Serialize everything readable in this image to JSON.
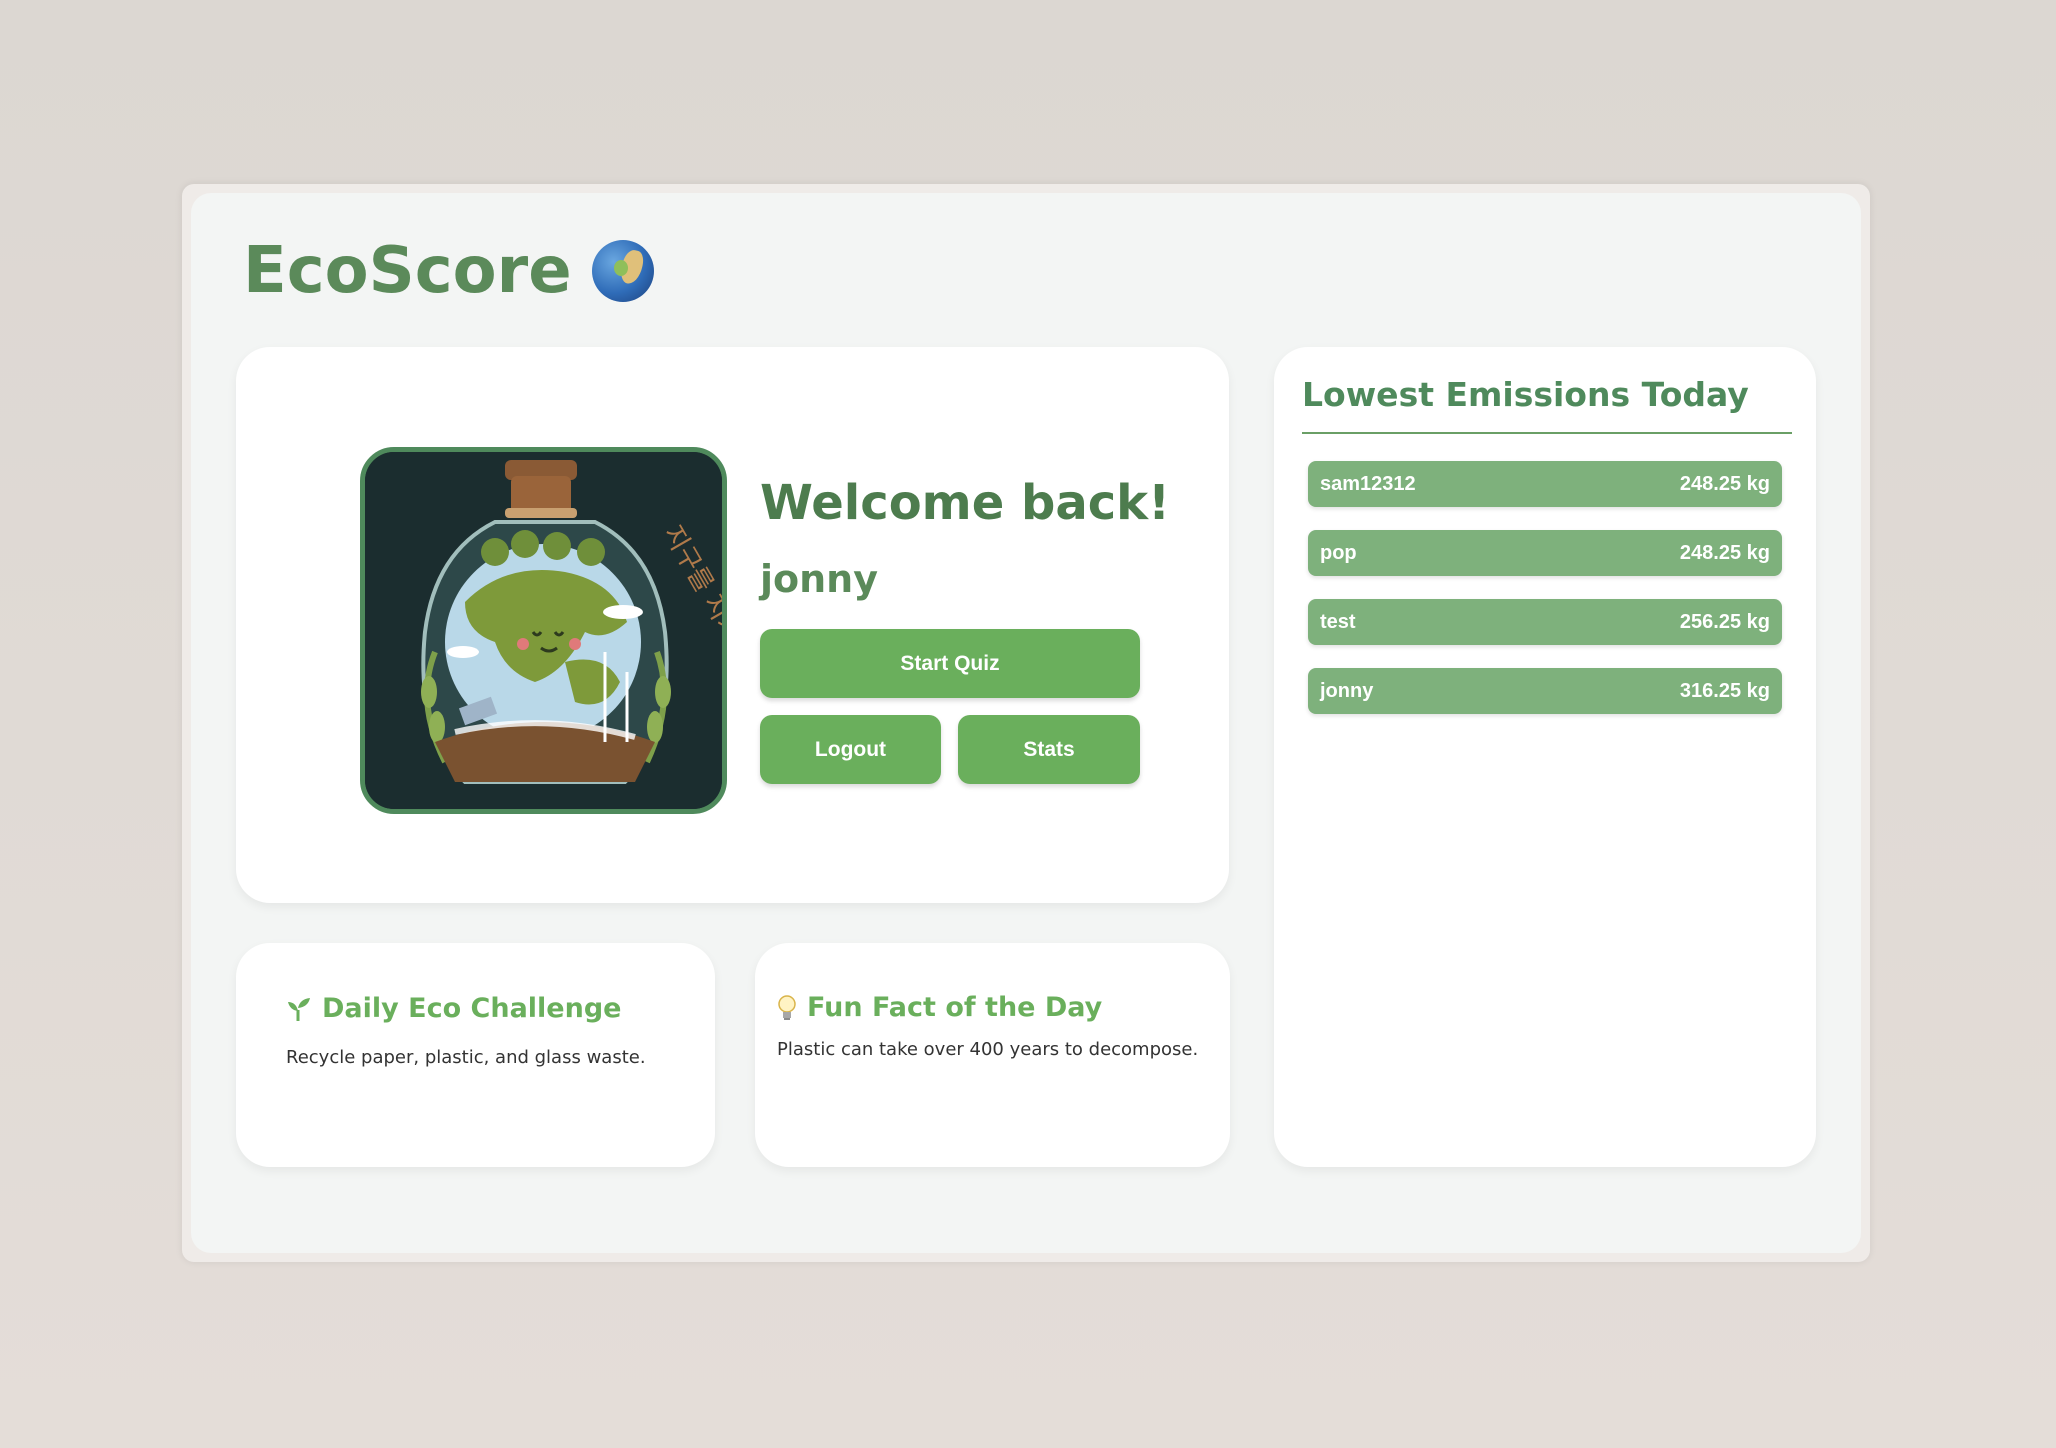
{
  "app": {
    "title": "EcoScore"
  },
  "welcome": {
    "greeting": "Welcome back!",
    "username": "jonny",
    "avatar_art_text": "지구를 지켜줘"
  },
  "buttons": {
    "start_quiz": "Start Quiz",
    "logout": "Logout",
    "stats": "Stats"
  },
  "challenge": {
    "title": "Daily Eco Challenge",
    "text": "Recycle paper, plastic, and glass waste."
  },
  "fact": {
    "title": "Fun Fact of the Day",
    "text": "Plastic can take over 400 years to decompose."
  },
  "leaderboard": {
    "title": "Lowest Emissions Today",
    "entries": [
      {
        "name": "sam12312",
        "value": "248.25 kg"
      },
      {
        "name": "pop",
        "value": "248.25 kg"
      },
      {
        "name": "test",
        "value": "256.25 kg"
      },
      {
        "name": "jonny",
        "value": "316.25 kg"
      }
    ]
  },
  "colors": {
    "brand_green": "#5b8a5a",
    "button_green": "#6aaf5c",
    "row_green": "#7eb17c",
    "avatar_bg": "#1b2d2f"
  },
  "icons": {
    "title_icon": "globe-icon",
    "challenge_icon": "sprout-icon",
    "fact_icon": "lightbulb-icon"
  }
}
